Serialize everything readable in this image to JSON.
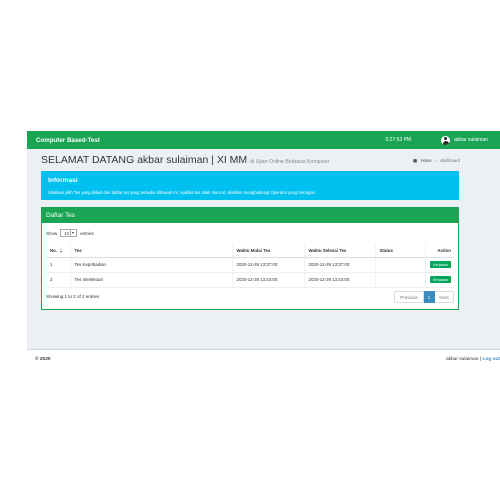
{
  "navbar": {
    "brand": "Computer Based-Test",
    "time": "5:27:53 PM",
    "user": "akbar sulaiman"
  },
  "page": {
    "title": "SELAMAT DATANG akbar sulaiman | XI MM",
    "subtitle": "di Ujian Online Berbasis Komputer"
  },
  "breadcrumb": {
    "home": "Home",
    "separator": ">",
    "current": "dashboard"
  },
  "info": {
    "title": "Informasi",
    "text": "Silahkan pilih Tes yang diikuti dari daftar tes yang tersedia dibawah ini. Apabila tes tidak muncul, silahkan menghubungi Operator yang bertugas."
  },
  "panel": {
    "title": "Daftar Tes"
  },
  "length": {
    "show": "Show",
    "value": "10",
    "entries": "entries"
  },
  "table": {
    "headers": [
      "No.",
      "Tes",
      "Waktu Mulai Tes",
      "Waktu Selesai Tes",
      "Status",
      "Action"
    ],
    "rows": [
      {
        "no": "1",
        "tes": "Tes Kepribadian",
        "mulai": "2020-12-28 13:37:00",
        "selesai": "2020-12-29 13:37:00",
        "status": "",
        "action": "Kerjakan"
      },
      {
        "no": "2",
        "tes": "Tes Intelektual",
        "mulai": "2020-12-28 13:44:00",
        "selesai": "2020-12-29 13:44:00",
        "status": "",
        "action": "Kerjakan"
      }
    ]
  },
  "table_info": "Showing 1 to 2 of 2 entries",
  "pagination": {
    "previous": "Previous",
    "page": "1",
    "next": "Next"
  },
  "footer": {
    "copyright": "© 2020",
    "user": "akbar sulaiman",
    "separator": "|",
    "logout": "Log out"
  },
  "colors": {
    "brand_green": "#1aa554",
    "info_blue": "#00c0ef",
    "button_green": "#00a65a",
    "page_bg": "#ecf0f5",
    "link_blue": "#3c8dbc"
  }
}
